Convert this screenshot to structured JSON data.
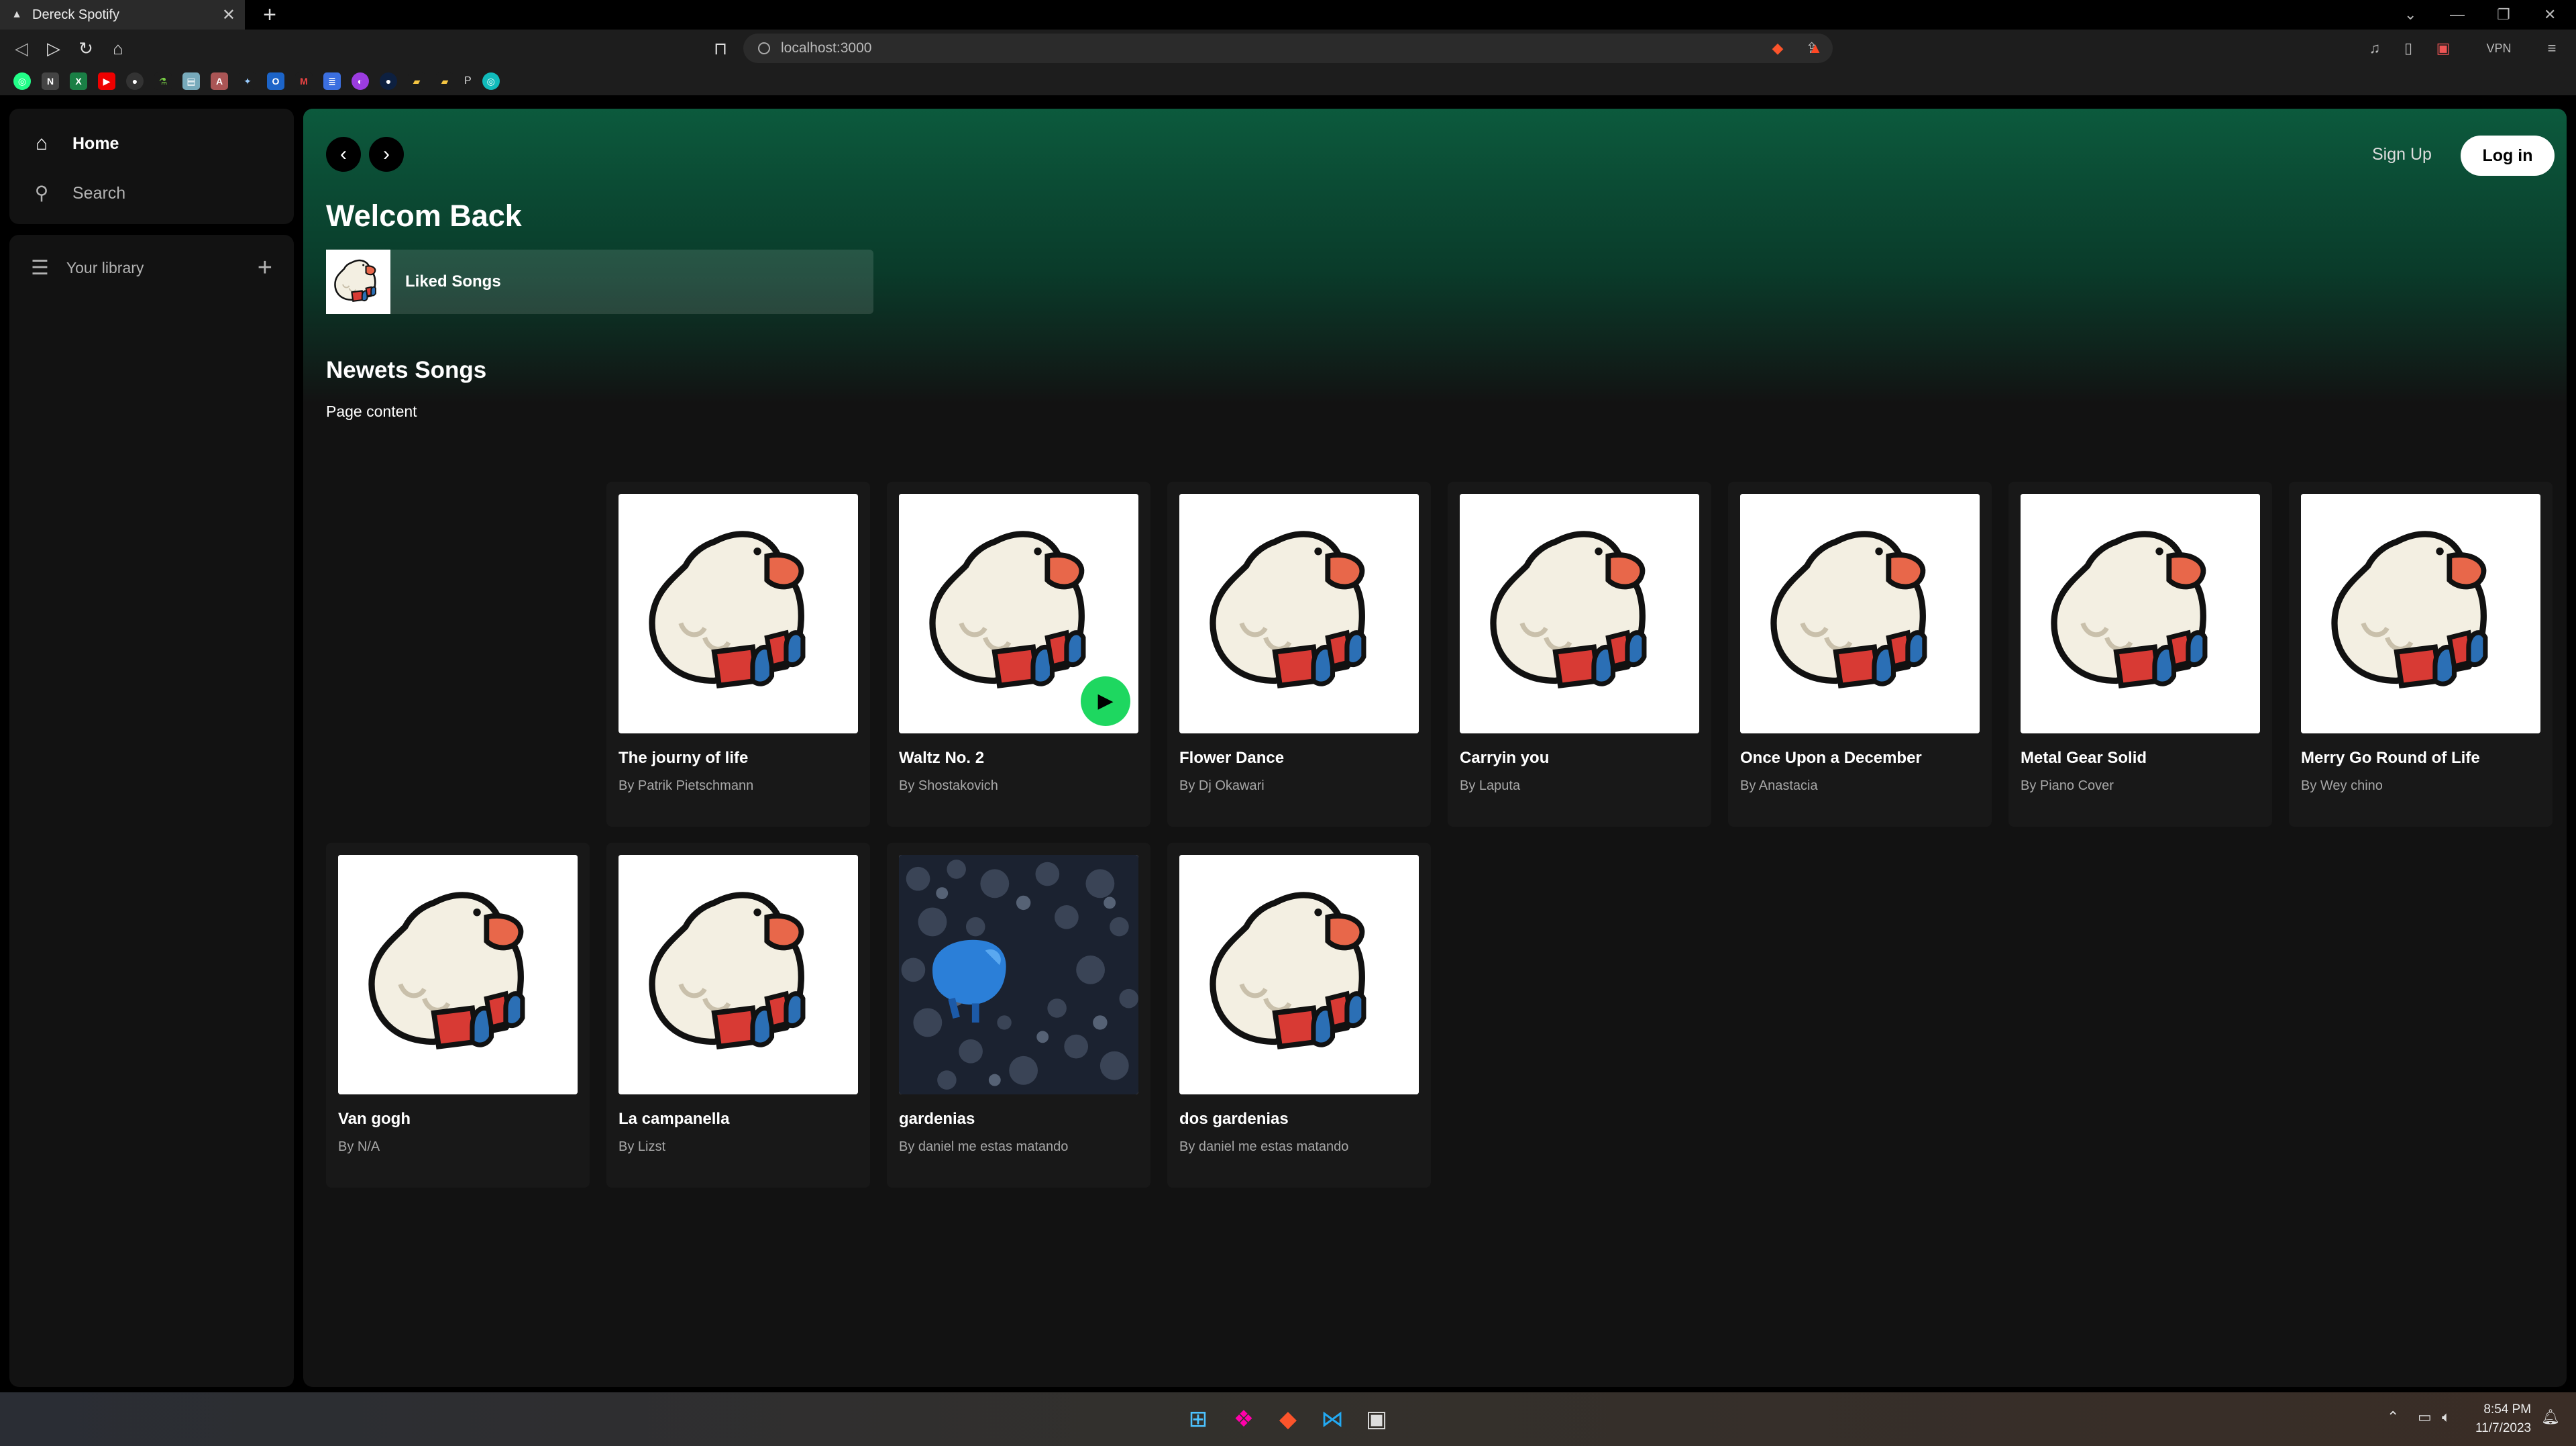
{
  "browser": {
    "tab_title": "Dereck Spotify",
    "tab_close": "✕",
    "new_tab": "+",
    "url": "localhost:3000",
    "bookmark_folder_label": "P"
  },
  "sidebar": {
    "items": [
      {
        "label": "Home",
        "icon": "home-icon"
      },
      {
        "label": "Search",
        "icon": "search-icon"
      }
    ],
    "library_label": "Your library",
    "library_add": "+"
  },
  "header": {
    "signup_label": "Sign Up",
    "login_label": "Log in"
  },
  "main": {
    "welcome": "Welcom Back",
    "liked_songs_label": "Liked Songs",
    "section_title": "Newets Songs",
    "page_content_label": "Page content",
    "songs": [
      {
        "title": "The journy of life",
        "author": "By Patrik Pietschmann",
        "art": "duck"
      },
      {
        "title": "Waltz No. 2",
        "author": "By Shostakovich",
        "art": "duck"
      },
      {
        "title": "Flower Dance",
        "author": "By Dj Okawari",
        "art": "duck"
      },
      {
        "title": "Carryin you",
        "author": "By Laputa",
        "art": "duck"
      },
      {
        "title": "Once Upon a December",
        "author": "By Anastacia",
        "art": "duck"
      },
      {
        "title": "Metal Gear Solid",
        "author": "By Piano Cover",
        "art": "duck"
      },
      {
        "title": "Merry Go Round of Life",
        "author": "By Wey chino",
        "art": "duck"
      },
      {
        "title": "Van gogh",
        "author": "By N/A",
        "art": "duck"
      },
      {
        "title": "La campanella",
        "author": "By Lizst",
        "art": "duck"
      },
      {
        "title": "gardenias",
        "author": "By daniel me estas matando",
        "art": "pebbles"
      },
      {
        "title": "dos gardenias",
        "author": "By daniel me estas matando",
        "art": "duck"
      }
    ]
  },
  "taskbar": {
    "time": "8:54 PM",
    "date": "11/7/2023",
    "vpn_label": "VPN"
  },
  "colors": {
    "accent_green": "#1ed760",
    "hero_green": "#0c5a3d",
    "background": "#121212",
    "card": "#181818"
  }
}
